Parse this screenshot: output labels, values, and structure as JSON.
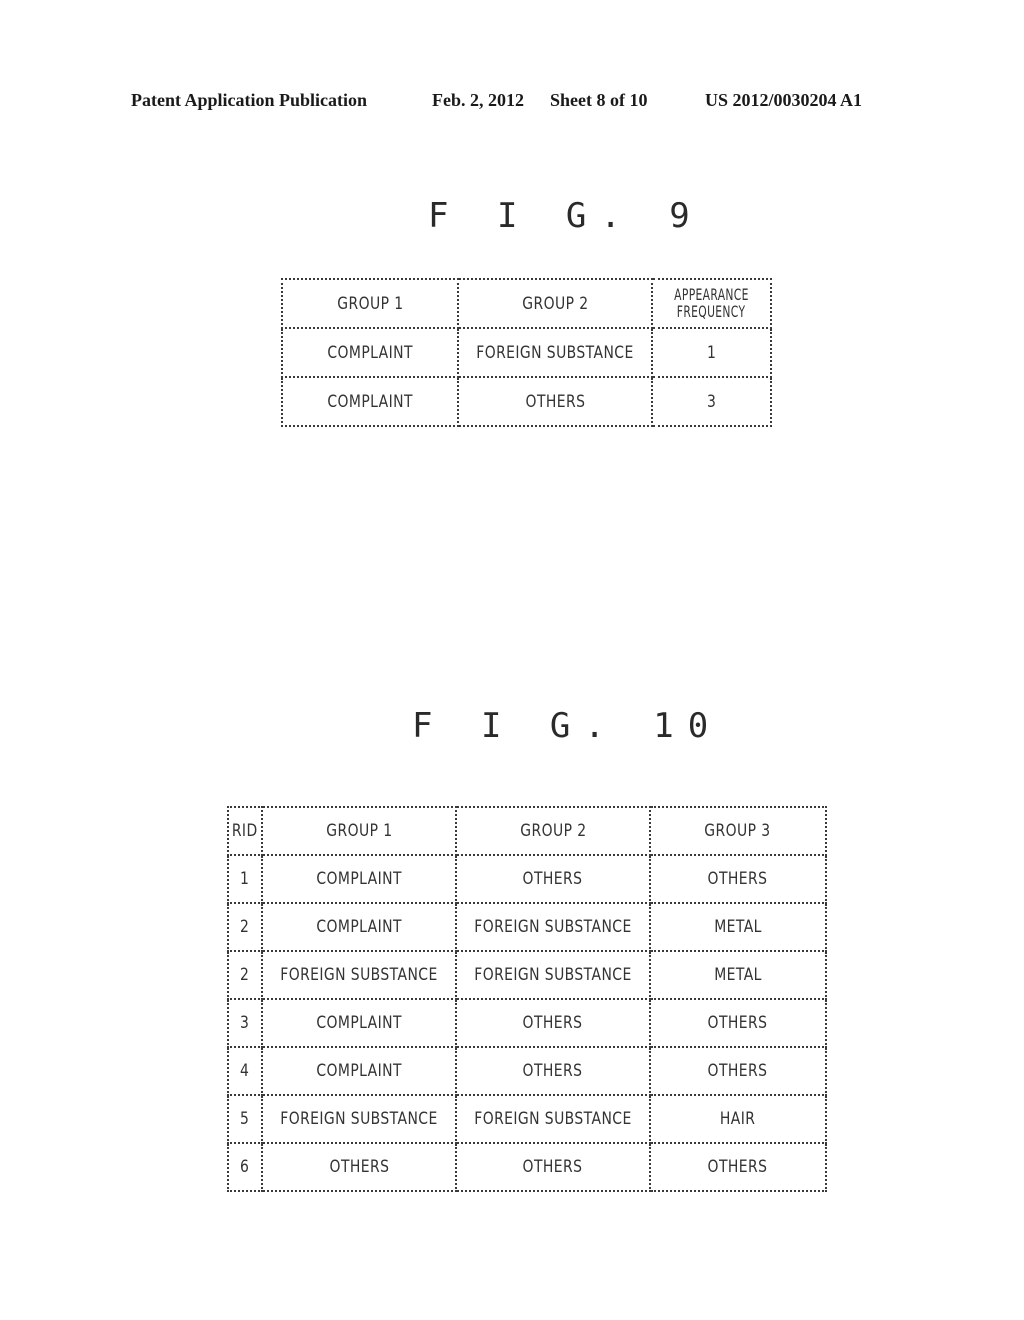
{
  "header": {
    "publication": "Patent Application Publication",
    "date": "Feb. 2, 2012",
    "sheet": "Sheet 8 of 10",
    "number": "US 2012/0030204 A1"
  },
  "fig9": {
    "title": "F I G. 9",
    "columns": [
      "GROUP 1",
      "GROUP 2",
      "APPEARANCE FREQUENCY"
    ],
    "column_lines": [
      [
        "GROUP 1"
      ],
      [
        "GROUP 2"
      ],
      [
        "APPEARANCE",
        "FREQUENCY"
      ]
    ],
    "rows": [
      [
        "COMPLAINT",
        "FOREIGN SUBSTANCE",
        "1"
      ],
      [
        "COMPLAINT",
        "OTHERS",
        "3"
      ]
    ]
  },
  "fig10": {
    "title": "F I G. 10",
    "columns": [
      "RID",
      "GROUP 1",
      "GROUP 2",
      "GROUP 3"
    ],
    "rows": [
      [
        "1",
        "COMPLAINT",
        "OTHERS",
        "OTHERS"
      ],
      [
        "2",
        "COMPLAINT",
        "FOREIGN SUBSTANCE",
        "METAL"
      ],
      [
        "2",
        "FOREIGN SUBSTANCE",
        "FOREIGN SUBSTANCE",
        "METAL"
      ],
      [
        "3",
        "COMPLAINT",
        "OTHERS",
        "OTHERS"
      ],
      [
        "4",
        "COMPLAINT",
        "OTHERS",
        "OTHERS"
      ],
      [
        "5",
        "FOREIGN SUBSTANCE",
        "FOREIGN SUBSTANCE",
        "HAIR"
      ],
      [
        "6",
        "OTHERS",
        "OTHERS",
        "OTHERS"
      ]
    ]
  }
}
